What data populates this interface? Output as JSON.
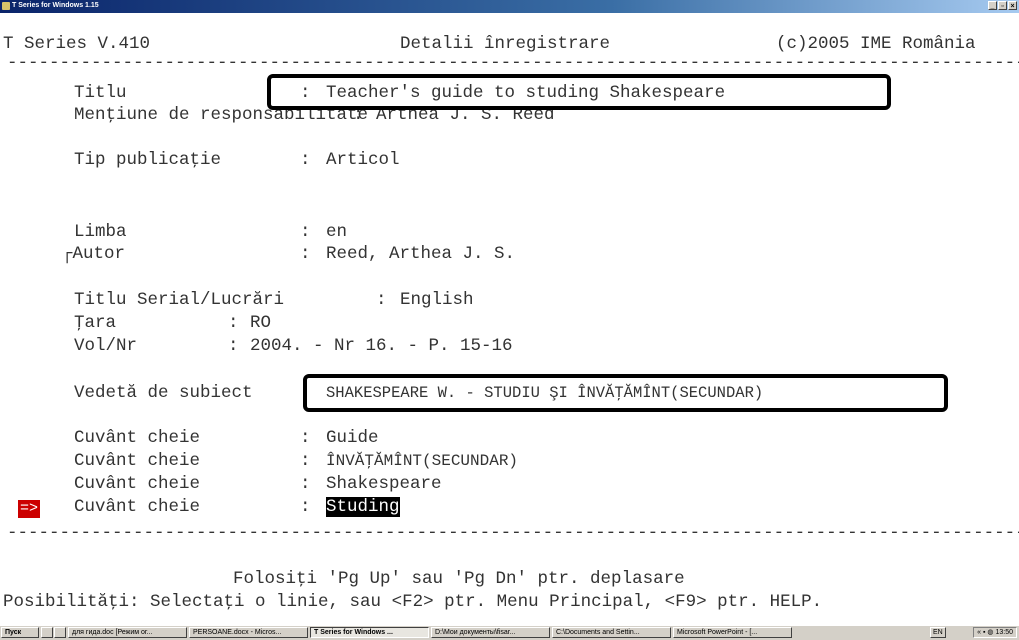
{
  "window": {
    "title": "T Series for Windows 1.15",
    "buttons": [
      "_",
      "▫",
      "×"
    ]
  },
  "header": {
    "app": "T Series V.410",
    "screen_title": "Detalii înregistrare",
    "copyright": "(c)2005 IME România"
  },
  "fields": [
    {
      "label": "Titlu",
      "sep": ":",
      "value": "Teacher's guide to studing Shakespeare"
    },
    {
      "label": "Menţiune de responsabilitate",
      "sep": ":",
      "value": "Arthea J. S. Reed"
    },
    {
      "label": "Tip publicaţie",
      "sep": ":",
      "value": "Articol"
    },
    {
      "label": "Limba",
      "sep": ":",
      "value": "en"
    },
    {
      "label": "┌Autor",
      "sep": ":",
      "value": "Reed, Arthea J. S."
    },
    {
      "label": "Titlu Serial/Lucrări",
      "sep": ":",
      "value": "English"
    },
    {
      "label": "Ţara",
      "sep": ":",
      "value": "RO"
    },
    {
      "label": "Vol/Nr",
      "sep": ":",
      "value": "2004. - Nr 16. - P. 15-16"
    },
    {
      "label": "Vedetă de subiect",
      "sep": ":",
      "value": "SHAKESPEARE W. - STUDIU ŞI ÎNVĂŢĂMÎNT(SECUNDAR)"
    },
    {
      "label": "Cuvânt cheie",
      "sep": ":",
      "value": "Guide"
    },
    {
      "label": "Cuvânt cheie",
      "sep": ":",
      "value": "ÎNVĂŢĂMÎNT(SECUNDAR)"
    },
    {
      "label": "Cuvânt cheie",
      "sep": ":",
      "value": "Shakespeare"
    },
    {
      "label": "Cuvânt cheie",
      "sep": ":",
      "value": "Studing"
    }
  ],
  "pointer": "=>",
  "footer": {
    "hint1": "Folosiţi 'Pg Up' sau 'Pg Dn' ptr. deplasare",
    "hint2": "Posibilităţi: Selectaţi o linie, sau <F2> ptr. Menu Principal, <F9> ptr. HELP."
  },
  "taskbar": {
    "start": "Пуск",
    "items": [
      "для гида.doc [Режим ог...",
      "PERSOANE.docx - Micros...",
      "T Series for Windows ...",
      "D:\\Мои документы\\fisar...",
      "C:\\Documents and Settin...",
      "Microsoft PowerPoint - [..."
    ],
    "lang": "EN",
    "clock": "13:50"
  }
}
